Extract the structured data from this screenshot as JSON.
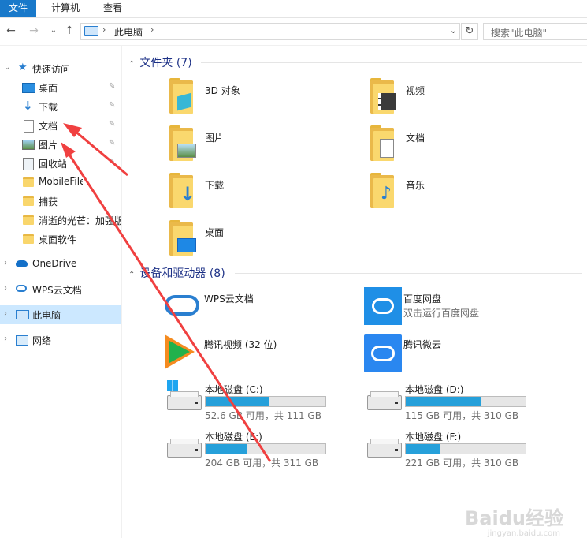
{
  "ribbon": {
    "tabs": [
      "文件",
      "计算机",
      "查看"
    ]
  },
  "nav": {
    "back": "←",
    "forward": "→",
    "recent": "⌄",
    "up": "↑"
  },
  "address": {
    "crumb": "此电脑",
    "sep": "›",
    "dropdown": "⌄",
    "refresh": "↻"
  },
  "search": {
    "placeholder": "搜索\"此电脑\""
  },
  "sidebar": {
    "items": [
      {
        "label": "快速访问",
        "icon": "star-icon"
      },
      {
        "label": "桌面",
        "icon": "desktop-icon",
        "pin": "📌"
      },
      {
        "label": "下载",
        "icon": "download-icon",
        "pin": "📌"
      },
      {
        "label": "文档",
        "icon": "document-icon",
        "pin": "📌"
      },
      {
        "label": "图片",
        "icon": "picture-icon",
        "pin": "📌"
      },
      {
        "label": "回收站",
        "icon": "recycle-bin-icon",
        "pin": "📌"
      },
      {
        "label": "MobileFile",
        "icon": "folder-icon"
      },
      {
        "label": "捕获",
        "icon": "folder-icon"
      },
      {
        "label": "消逝的光芒：加强版",
        "icon": "folder-icon"
      },
      {
        "label": "桌面软件",
        "icon": "folder-icon"
      },
      {
        "label": "OneDrive",
        "icon": "cloud-icon"
      },
      {
        "label": "WPS云文档",
        "icon": "wps-cloud-icon"
      },
      {
        "label": "此电脑",
        "icon": "computer-icon"
      },
      {
        "label": "网络",
        "icon": "network-icon"
      }
    ]
  },
  "folders_group": {
    "title": "文件夹 (7)"
  },
  "folders": [
    {
      "label": "3D 对象"
    },
    {
      "label": "视频"
    },
    {
      "label": "图片"
    },
    {
      "label": "文档"
    },
    {
      "label": "下载"
    },
    {
      "label": "音乐"
    },
    {
      "label": "桌面"
    }
  ],
  "devices_group": {
    "title": "设备和驱动器 (8)"
  },
  "apps": [
    {
      "name": "WPS云文档",
      "sub": ""
    },
    {
      "name": "百度网盘",
      "sub": "双击运行百度网盘"
    },
    {
      "name": "腾讯视频 (32 位)",
      "sub": ""
    },
    {
      "name": "腾讯微云",
      "sub": ""
    }
  ],
  "drives": [
    {
      "name": "本地磁盘 (C:)",
      "info": "52.6 GB 可用，共 111 GB",
      "used_fraction": 0.53
    },
    {
      "name": "本地磁盘 (D:)",
      "info": "115 GB 可用，共 310 GB",
      "used_fraction": 0.63
    },
    {
      "name": "本地磁盘 (E:)",
      "info": "204 GB 可用，共 311 GB",
      "used_fraction": 0.34
    },
    {
      "name": "本地磁盘 (F:)",
      "info": "221 GB 可用，共 310 GB",
      "used_fraction": 0.29
    }
  ],
  "colors": {
    "accent": "#1979ca",
    "annotation_arrow": "#f04040",
    "drive_fill": "#26a0da",
    "group_title": "#1e3287"
  },
  "watermark": {
    "brand": "Baidu经验",
    "url": "jingyan.baidu.com"
  }
}
